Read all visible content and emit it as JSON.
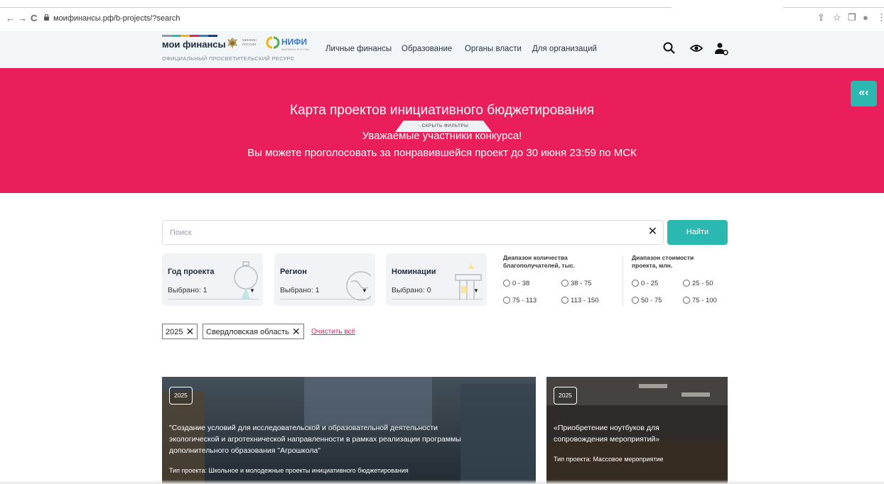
{
  "browser": {
    "url": "моифинансы.рф/b-projects/?search",
    "nav": {
      "back": "←",
      "forward": "→",
      "reload": "C"
    },
    "ext_icons": {
      "share": "⇪",
      "star": "☆",
      "panel": "❐",
      "profile": "●",
      "menu": "⋮"
    }
  },
  "header": {
    "logo_title": "мои финансы",
    "logo_subtitle": "ОФИЦИАЛЬНЫЙ ПРОСВЕТИТЕЛЬСКИЙ РЕСУРС",
    "minfin_label": "МИНФИН РОССИИ",
    "nifi_label": "НИФИ",
    "nifi_sub": "МИНФИНА РОССИИ",
    "menu": [
      {
        "label": "Личные финансы"
      },
      {
        "label": "Образование"
      },
      {
        "label": "Органы власти"
      },
      {
        "label": "Для организаций"
      }
    ]
  },
  "hero": {
    "title": "Карта проектов инициативного бюджетирования",
    "subtitle_line1": "Уважаемые участники конкурса!",
    "subtitle_line2": "Вы можете проголосовать за понравившейся проект до 30 июня 23:59 по МСК",
    "collapse_glyph": "«‹",
    "hide_filters": "- СКРЫТЬ ФИЛЬТРЫ",
    "bg_color": "#e91e5a"
  },
  "search": {
    "placeholder": "Поиск",
    "clear_glyph": "✕",
    "button": "Найти",
    "accent": "#2bb8b1"
  },
  "filters": [
    {
      "title": "Год проекта",
      "value": "Выбрано: 1"
    },
    {
      "title": "Регион",
      "value": "Выбрано: 1"
    },
    {
      "title": "Номинации",
      "value": "Выбрано: 0"
    }
  ],
  "caret": "▼",
  "ranges": {
    "beneficiaries": {
      "title_line1": "Диапазон количества",
      "title_line2": "благополучателей, тыс.",
      "options": [
        "0 - 38",
        "38 - 75",
        "75 - 113",
        "113 - 150"
      ]
    },
    "cost": {
      "title_line1": "Диапазон стоимости",
      "title_line2": "проекта, млн.",
      "options": [
        "0 - 25",
        "25 - 50",
        "50 - 75",
        "75 - 100"
      ]
    }
  },
  "chips": [
    {
      "label": "2025",
      "x": "✕"
    },
    {
      "label": "Свердловская область",
      "x": "✕"
    }
  ],
  "clear_all": "Очистить всё",
  "projects": [
    {
      "year": "2025",
      "title_line1": "\"Создание условий для исследовательской и образовательной деятельности",
      "title_line2": "экологической и агротехнической направленности в рамках реализации программы",
      "title_line3": "дополнительного образования \"Агрошкола\"",
      "type": "Тип проекта: Школьное и молодежные проекты инициативного бюджетирования"
    },
    {
      "year": "2025",
      "title_line1": "«Приобретение ноутбуков для",
      "title_line2": "сопровождения мероприятий»",
      "type": "Тип проекта: Массовое мероприятие"
    }
  ]
}
